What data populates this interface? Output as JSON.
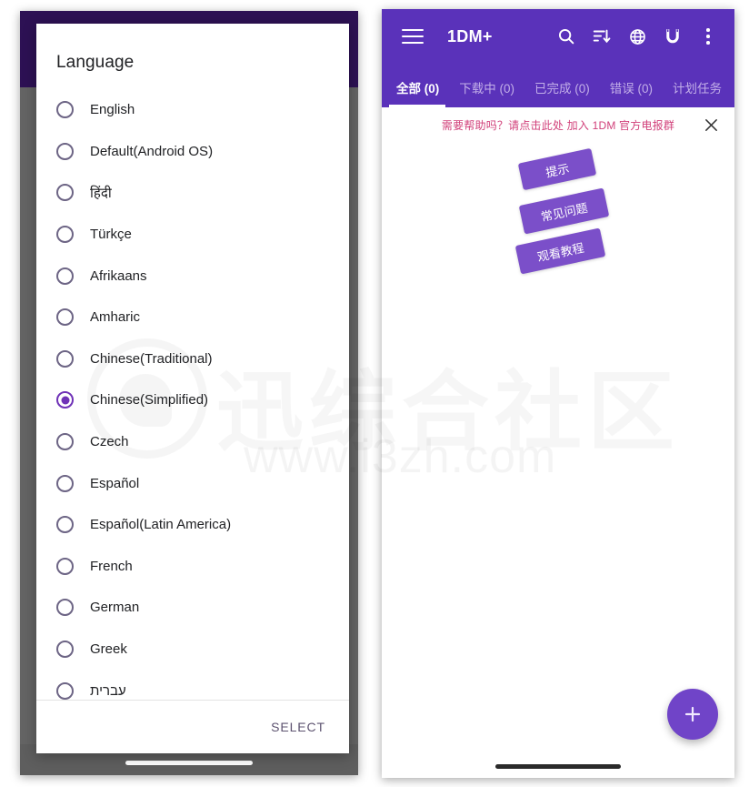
{
  "left_phone": {
    "app_bar": {
      "menu_icon": "hamburger-menu-icon",
      "overflow_icon": "more-vertical-icon"
    },
    "dialog": {
      "title": "Language",
      "select_label": "SELECT",
      "options": [
        {
          "label": "English",
          "selected": false
        },
        {
          "label": "Default(Android OS)",
          "selected": false
        },
        {
          "label": "हिंदी",
          "selected": false
        },
        {
          "label": "Türkçe",
          "selected": false
        },
        {
          "label": "Afrikaans",
          "selected": false
        },
        {
          "label": "Amharic",
          "selected": false
        },
        {
          "label": "Chinese(Traditional)",
          "selected": false
        },
        {
          "label": "Chinese(Simplified)",
          "selected": true
        },
        {
          "label": "Czech",
          "selected": false
        },
        {
          "label": "Español",
          "selected": false
        },
        {
          "label": "Español(Latin America)",
          "selected": false
        },
        {
          "label": "French",
          "selected": false
        },
        {
          "label": "German",
          "selected": false
        },
        {
          "label": "Greek",
          "selected": false
        },
        {
          "label": "עברית",
          "selected": false
        }
      ]
    }
  },
  "right_phone": {
    "app_bar": {
      "menu_icon": "hamburger-menu-icon",
      "title": "1DM+",
      "actions": [
        {
          "name": "search-icon",
          "label": "search"
        },
        {
          "name": "sort-icon",
          "label": "sort"
        },
        {
          "name": "globe-icon",
          "label": "browser"
        },
        {
          "name": "magnet-icon",
          "label": "magnet"
        },
        {
          "name": "more-vertical-icon",
          "label": "more options"
        }
      ]
    },
    "tabs": [
      {
        "label": "全部 (0)",
        "active": true
      },
      {
        "label": "下载中 (0)",
        "active": false
      },
      {
        "label": "已完成 (0)",
        "active": false
      },
      {
        "label": "错误 (0)",
        "active": false
      },
      {
        "label": "计划任务",
        "active": false
      }
    ],
    "banner": {
      "text": "需要帮助吗？请点击此处 加入 1DM 官方电报群",
      "close_icon": "close-icon"
    },
    "chips": [
      {
        "label": "提示"
      },
      {
        "label": "常见问题"
      },
      {
        "label": "观看教程"
      }
    ],
    "fab": {
      "icon": "plus-icon"
    }
  },
  "watermark": {
    "site_name": "迅综合社区",
    "url": "www.i3zh.com"
  },
  "colors": {
    "primary_purple": "#5a32ba",
    "accent_purple": "#6f32b7",
    "fab_purple": "#7044c8",
    "chip_purple": "#7b4fc9",
    "dark_appbar": "#2d1154",
    "banner_pink": "#d1407a",
    "scrim_gray": "#646464"
  }
}
